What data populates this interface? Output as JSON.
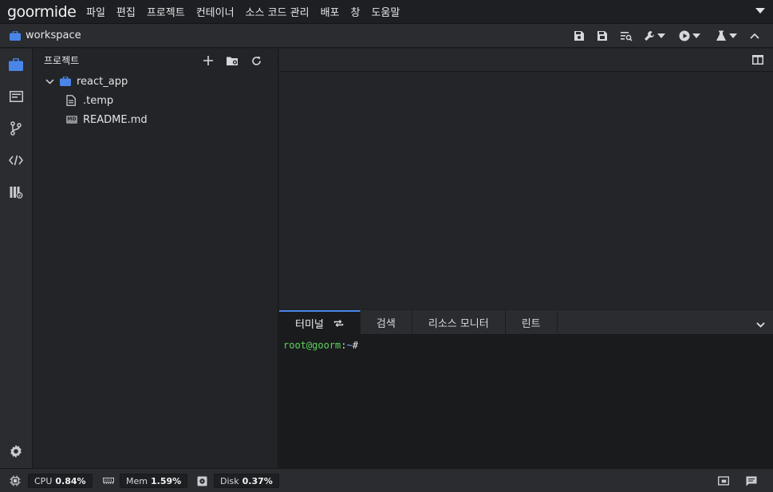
{
  "menubar": {
    "logo": "goormide",
    "items": [
      "파일",
      "편집",
      "프로젝트",
      "컨테이너",
      "소스 코드 관리",
      "배포",
      "창",
      "도움말"
    ]
  },
  "workspace": {
    "title": "workspace"
  },
  "project": {
    "header": "프로젝트",
    "tree": [
      {
        "name": "react_app",
        "type": "folder",
        "expanded": true
      },
      {
        "name": ".temp",
        "type": "file"
      },
      {
        "name": "README.md",
        "type": "markdown",
        "badge": "MD"
      }
    ]
  },
  "bottom_panel": {
    "tabs": [
      "터미널",
      "검색",
      "리소스 모니터",
      "린트"
    ],
    "active_tab": "터미널",
    "terminal": {
      "user": "root@goorm",
      "colon": ":",
      "path": "~",
      "prompt": "#"
    }
  },
  "status": {
    "cpu_label": "CPU",
    "cpu_value": "0.84%",
    "mem_label": "Mem",
    "mem_value": "1.59%",
    "disk_label": "Disk",
    "disk_value": "0.37%"
  },
  "colors": {
    "accent": "#4a86e8",
    "folder": "#4a86e8",
    "terminal_user": "#5fd35f",
    "terminal_path": "#6ea8f5"
  }
}
